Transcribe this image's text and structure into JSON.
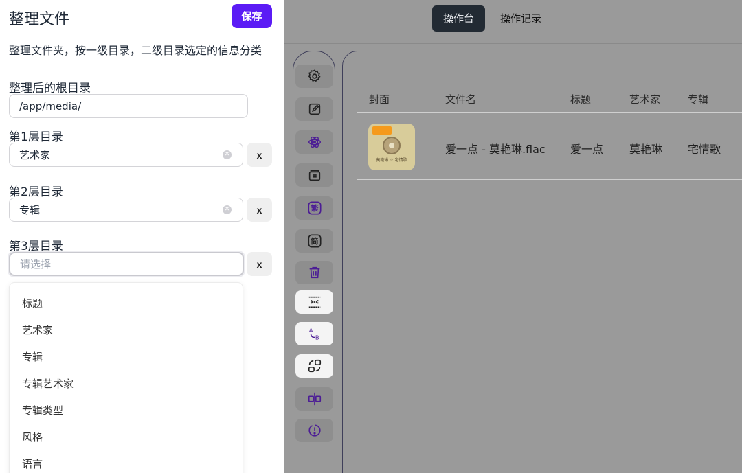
{
  "drawer": {
    "title": "整理文件",
    "save_label": "保存",
    "description": "整理文件夹，按一级目录，二级目录选定的信息分类",
    "root_label": "整理后的根目录",
    "root_value": "/app/media/",
    "level1_label": "第1层目录",
    "level1_value": "艺术家",
    "level2_label": "第2层目录",
    "level2_value": "专辑",
    "level3_label": "第3层目录",
    "level3_placeholder": "请选择",
    "remove_label": "x",
    "options": [
      "标题",
      "艺术家",
      "专辑",
      "专辑艺术家",
      "专辑类型",
      "风格",
      "语言"
    ]
  },
  "topnav": {
    "tabs": [
      "操作台",
      "操作记录"
    ],
    "active": "操作台"
  },
  "table": {
    "headers": [
      "封面",
      "文件名",
      "标题",
      "艺术家",
      "专辑"
    ],
    "rows": [
      {
        "cover_caption": "莫艳琳 ☆ 宅情歌",
        "filename": "爱一点 - 莫艳琳.flac",
        "title": "爱一点",
        "artist": "莫艳琳",
        "album": "宅情歌"
      }
    ]
  },
  "toolbar": {
    "icons": [
      "gear-icon",
      "edit-icon",
      "atom-icon",
      "package-icon",
      "traditional-chinese-icon",
      "simplified-chinese-icon",
      "trash-icon",
      "spacing-icon",
      "replace-icon",
      "swap-icon",
      "align-center-icon",
      "alert-icon"
    ],
    "traditional_glyph": "繁",
    "simplified_glyph": "简",
    "ab_a": "A",
    "ab_b": "B"
  },
  "colors": {
    "accent": "#5b1bf5",
    "icon": "#4c1d95",
    "overlay": "#9a9a9a"
  }
}
